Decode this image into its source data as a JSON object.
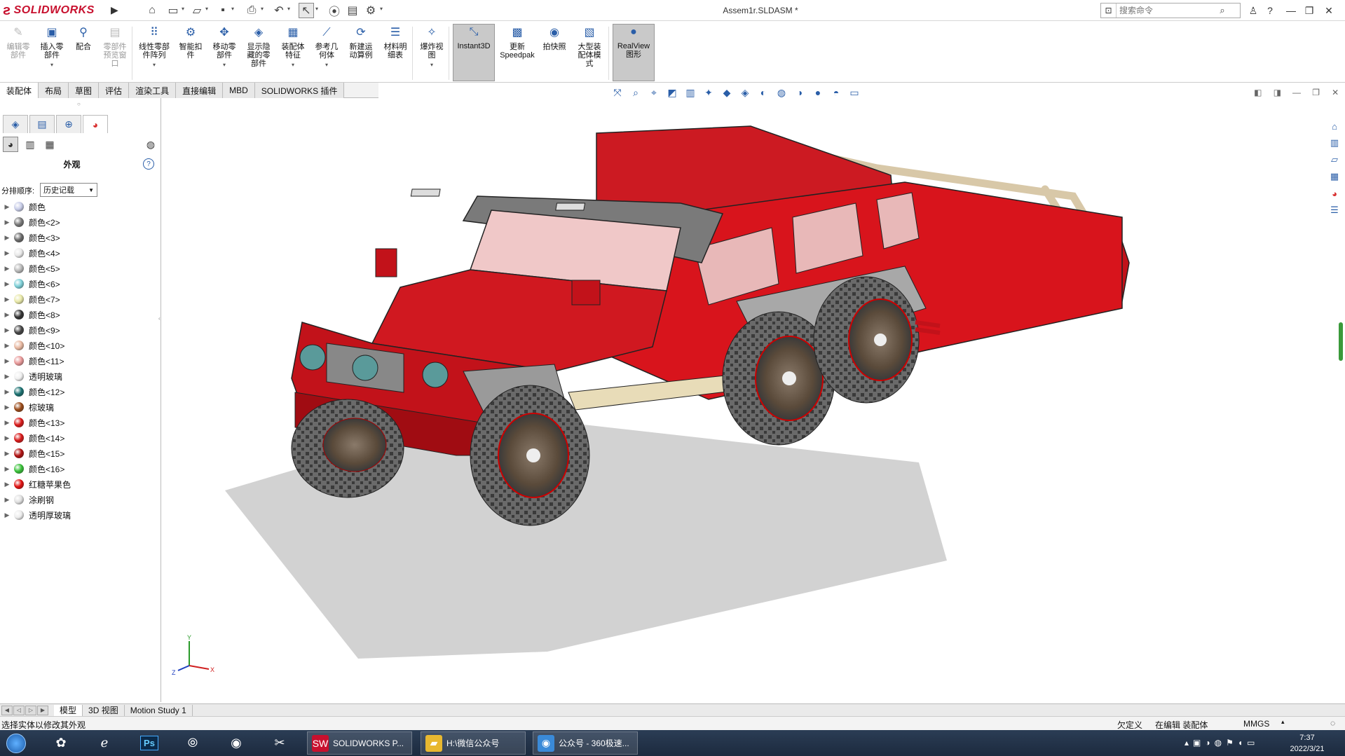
{
  "app": {
    "logo_text": "SOLIDWORKS",
    "doc_title": "Assem1r.SLDASM *",
    "search_placeholder": "搜索命令"
  },
  "quick_access": [
    "home-icon",
    "new-document-icon",
    "open-icon",
    "save-icon",
    "print-icon",
    "undo-icon",
    "select-pointer-icon",
    "traffic-light-icon",
    "file-properties-icon",
    "options-gear-icon"
  ],
  "ribbon": [
    {
      "name": "edit-component",
      "label": "编辑零\n部件",
      "icon": "✎",
      "disabled": true
    },
    {
      "name": "insert-component",
      "label": "插入零\n部件",
      "icon": "▣",
      "caret": true
    },
    {
      "name": "mate",
      "label": "配合",
      "icon": "⚲"
    },
    {
      "name": "component-preview",
      "label": "零部件\n预览窗\n口",
      "icon": "▤",
      "disabled": true
    },
    {
      "name": "linear-pattern",
      "label": "线性零部\n件阵列",
      "icon": "⠿",
      "caret": true
    },
    {
      "name": "smart-fasteners",
      "label": "智能扣\n件",
      "icon": "⚙"
    },
    {
      "name": "move-component",
      "label": "移动零\n部件",
      "icon": "✥",
      "caret": true
    },
    {
      "name": "show-hidden",
      "label": "显示隐\n藏的零\n部件",
      "icon": "◈"
    },
    {
      "name": "assembly-features",
      "label": "装配体\n特征",
      "icon": "▦",
      "caret": true
    },
    {
      "name": "reference-geometry",
      "label": "参考几\n何体",
      "icon": "⟋",
      "caret": true
    },
    {
      "name": "new-motion-study",
      "label": "新建运\n动算例",
      "icon": "⟳"
    },
    {
      "name": "bom",
      "label": "材料明\n细表",
      "icon": "☰"
    },
    {
      "name": "exploded-view",
      "label": "爆炸视\n图",
      "icon": "✧",
      "caret": true
    },
    {
      "name": "instant3d",
      "label": "Instant3D",
      "icon": "⤡",
      "active": true
    },
    {
      "name": "update-speedpak",
      "label": "更新\nSpeedpak",
      "icon": "▩"
    },
    {
      "name": "take-snapshot",
      "label": "拍快照",
      "icon": "◉"
    },
    {
      "name": "large-assembly-mode",
      "label": "大型装\n配体模\n式",
      "icon": "▧"
    },
    {
      "name": "realview",
      "label": "RealView\n图形",
      "icon": "●",
      "active": true
    }
  ],
  "command_tabs": [
    "装配体",
    "布局",
    "草图",
    "评估",
    "渲染工具",
    "直接编辑",
    "MBD",
    "SOLIDWORKS 插件"
  ],
  "panel": {
    "title": "外观",
    "sort_label": "分排顺序:",
    "sort_value": "历史记载",
    "items": [
      {
        "label": "颜色",
        "color": "#c8cde8"
      },
      {
        "label": "颜色<2>",
        "color": "#777777"
      },
      {
        "label": "颜色<3>",
        "color": "#6a6a6a"
      },
      {
        "label": "颜色<4>",
        "color": "#e8e8e8"
      },
      {
        "label": "颜色<5>",
        "color": "#b8b8b8"
      },
      {
        "label": "颜色<6>",
        "color": "#7ed0d8"
      },
      {
        "label": "颜色<7>",
        "color": "#e8e8a8"
      },
      {
        "label": "颜色<8>",
        "color": "#333333"
      },
      {
        "label": "颜色<9>",
        "color": "#444444"
      },
      {
        "label": "颜色<10>",
        "color": "#e8b8a0"
      },
      {
        "label": "颜色<11>",
        "color": "#e89898"
      },
      {
        "label": "透明玻璃",
        "color": "#f0f0f0"
      },
      {
        "label": "颜色<12>",
        "color": "#1a7070"
      },
      {
        "label": "棕玻璃",
        "color": "#9a4a18"
      },
      {
        "label": "颜色<13>",
        "color": "#d81818"
      },
      {
        "label": "颜色<14>",
        "color": "#d81818"
      },
      {
        "label": "颜色<15>",
        "color": "#b01010"
      },
      {
        "label": "颜色<16>",
        "color": "#38c038"
      },
      {
        "label": "红糖苹果色",
        "color": "#e01010"
      },
      {
        "label": "涂刷钢",
        "color": "#e0e0e0"
      },
      {
        "label": "透明厚玻璃",
        "color": "#ececec"
      }
    ]
  },
  "bottom_tabs": [
    "模型",
    "3D 视图",
    "Motion Study 1"
  ],
  "status": {
    "message": "选择实体以修改其外观",
    "definition": "欠定义",
    "editing": "在编辑 装配体",
    "units": "MMGS"
  },
  "taskbar": {
    "tasks": [
      {
        "label": "SOLIDWORKS P...",
        "color": "#c8102e",
        "icon": "SW"
      },
      {
        "label": "H:\\微信公众号",
        "color": "#e8b830",
        "icon": "▰"
      },
      {
        "label": "公众号 - 360极速...",
        "color": "#3a8ad8",
        "icon": "◉"
      }
    ],
    "time": "7:37",
    "date": "2022/3/21"
  },
  "colors": {
    "body_red": "#d8141c",
    "body_dark": "#a00c12",
    "tire": "#555555",
    "shadow": "#cfcfcf"
  }
}
